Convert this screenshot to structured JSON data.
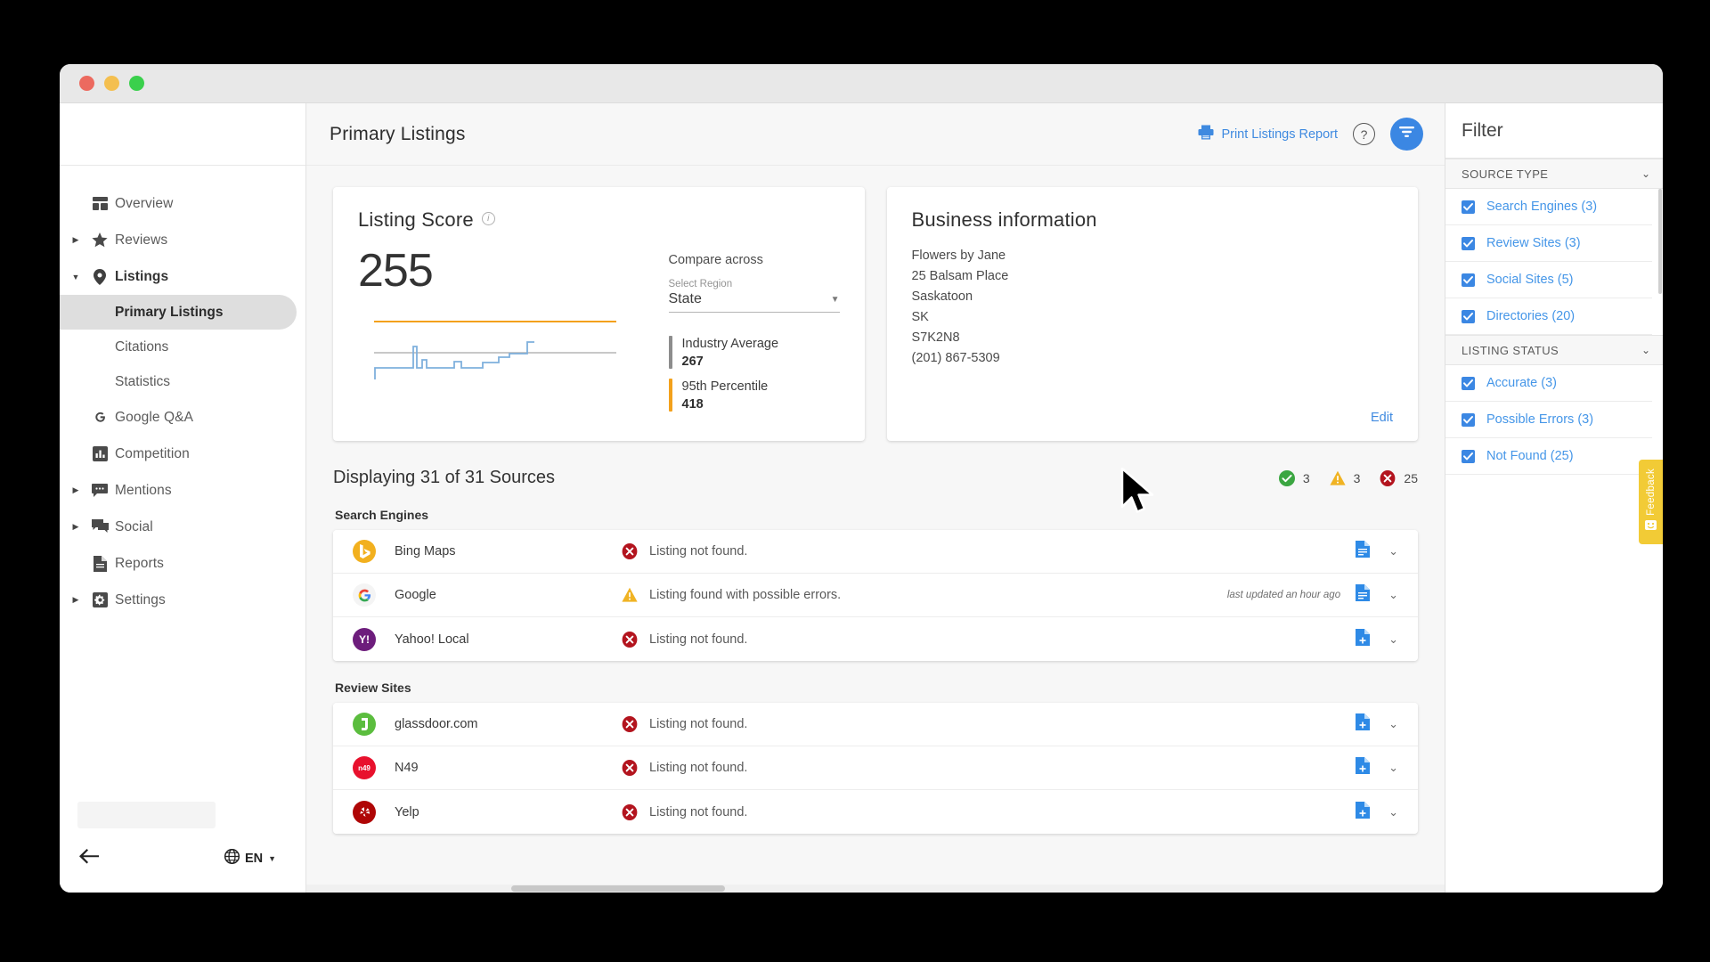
{
  "window": {
    "traffic_lights": [
      "close",
      "minimize",
      "maximize"
    ]
  },
  "sidebar": {
    "items": [
      {
        "label": "Overview",
        "icon": "dashboard-icon",
        "expandable": false,
        "expanded": false
      },
      {
        "label": "Reviews",
        "icon": "star-icon",
        "expandable": true,
        "expanded": false
      },
      {
        "label": "Listings",
        "icon": "location-pin-icon",
        "expandable": true,
        "expanded": true
      },
      {
        "label": "Google Q&A",
        "icon": "google-g-icon",
        "expandable": false,
        "expanded": false
      },
      {
        "label": "Competition",
        "icon": "bar-chart-icon",
        "expandable": false,
        "expanded": false
      },
      {
        "label": "Mentions",
        "icon": "comment-dots-icon",
        "expandable": true,
        "expanded": false
      },
      {
        "label": "Social",
        "icon": "chat-bubbles-icon",
        "expandable": true,
        "expanded": false
      },
      {
        "label": "Reports",
        "icon": "document-icon",
        "expandable": false,
        "expanded": false
      },
      {
        "label": "Settings",
        "icon": "gear-icon",
        "expandable": true,
        "expanded": false
      }
    ],
    "listings_children": [
      {
        "label": "Primary Listings",
        "active": true
      },
      {
        "label": "Citations",
        "active": false
      },
      {
        "label": "Statistics",
        "active": false
      }
    ],
    "footer": {
      "back_icon": "arrow-left-icon",
      "lang_icon": "globe-icon",
      "lang": "EN",
      "lang_caret": "▾"
    }
  },
  "topbar": {
    "title": "Primary Listings",
    "print_label": "Print Listings Report",
    "print_icon": "printer-icon",
    "help_icon": "question-mark-icon",
    "filter_icon": "filter-funnel-icon",
    "accent": "#3b87e3"
  },
  "listing_score": {
    "title": "Listing Score",
    "info_icon": "info-icon",
    "score": "255",
    "compare_label": "Compare across",
    "select_label": "Select Region",
    "select_value": "State",
    "select_caret": "▾",
    "legend": [
      {
        "name": "Industry Average",
        "value": "267",
        "color": "#8d8d8d"
      },
      {
        "name": "95th Percentile",
        "value": "418",
        "color": "#f3a11c"
      }
    ]
  },
  "chart_data": {
    "type": "line",
    "title": "Listing Score",
    "xlabel": "",
    "ylabel": "",
    "ylim": [
      0,
      460
    ],
    "grid": false,
    "legend_position": "right",
    "series": [
      {
        "name": "Listing Score",
        "color": "#7fb0dd",
        "values": [
          120,
          120,
          120,
          215,
          215,
          215,
          215,
          215,
          215,
          215,
          215,
          215,
          215,
          215,
          215,
          215,
          215,
          215,
          330,
          215,
          215,
          240,
          215,
          215,
          215,
          215,
          215,
          215,
          215,
          215,
          215,
          215,
          215,
          215,
          215,
          240,
          215,
          215,
          215,
          215,
          215,
          215,
          240,
          255,
          255,
          255,
          255,
          255,
          255,
          255,
          255,
          255,
          255,
          255,
          255,
          255,
          255,
          255,
          255,
          255,
          255,
          330,
          330
        ]
      },
      {
        "name": "Industry Average",
        "color": "#a8a8a8",
        "type": "hline",
        "value": 267
      },
      {
        "name": "95th Percentile",
        "color": "#f3a11c",
        "type": "hline",
        "value": 418
      }
    ],
    "annotations": [
      {
        "label": "Industry Average",
        "value": 267
      },
      {
        "label": "95th Percentile",
        "value": 418
      }
    ]
  },
  "business_info": {
    "title": "Business information",
    "lines": [
      "Flowers by Jane",
      "25 Balsam Place",
      "Saskatoon",
      "SK",
      "S7K2N8",
      "(201) 867-5309"
    ],
    "edit_label": "Edit"
  },
  "sources": {
    "heading": "Displaying 31 of 31 Sources",
    "counts": [
      {
        "status": "accurate",
        "icon": "check-circle-icon",
        "value": "3",
        "color": "#3ba641"
      },
      {
        "status": "possible-errors",
        "icon": "warning-triangle-icon",
        "value": "3",
        "color": "#f0b323"
      },
      {
        "status": "not-found",
        "icon": "error-circle-icon",
        "value": "25",
        "color": "#b3141e"
      }
    ],
    "groups": [
      {
        "title": "Search Engines",
        "rows": [
          {
            "name": "Bing Maps",
            "logo": "bing-icon",
            "logo_bg": "#f2b01e",
            "status_icon": "error-circle-icon",
            "status": "Listing not found.",
            "updated": "",
            "action_icon": "document-icon",
            "chevron": "chevron-down-icon"
          },
          {
            "name": "Google",
            "logo": "google-icon",
            "logo_bg": "#ffffff",
            "status_icon": "warning-triangle-icon",
            "status": "Listing found with possible errors.",
            "updated": "last updated an hour ago",
            "action_icon": "document-icon",
            "chevron": "chevron-down-icon"
          },
          {
            "name": "Yahoo! Local",
            "logo": "yahoo-icon",
            "logo_bg": "#6d1d7c",
            "status_icon": "error-circle-icon",
            "status": "Listing not found.",
            "updated": "",
            "action_icon": "document-add-icon",
            "chevron": "chevron-down-icon"
          }
        ]
      },
      {
        "title": "Review Sites",
        "rows": [
          {
            "name": "glassdoor.com",
            "logo": "glassdoor-icon",
            "logo_bg": "#5bbd3e",
            "status_icon": "error-circle-icon",
            "status": "Listing not found.",
            "updated": "",
            "action_icon": "document-add-icon",
            "chevron": "chevron-down-icon"
          },
          {
            "name": "N49",
            "logo": "n49-icon",
            "logo_bg": "#e8112d",
            "status_icon": "error-circle-icon",
            "status": "Listing not found.",
            "updated": "",
            "action_icon": "document-add-icon",
            "chevron": "chevron-down-icon"
          },
          {
            "name": "Yelp",
            "logo": "yelp-icon",
            "logo_bg": "#af0606",
            "status_icon": "error-circle-icon",
            "status": "Listing not found.",
            "updated": "",
            "action_icon": "document-add-icon",
            "chevron": "chevron-down-icon"
          }
        ]
      }
    ]
  },
  "filter": {
    "title": "Filter",
    "sections": [
      {
        "label": "SOURCE TYPE",
        "caret": "chevron-down-icon",
        "options": [
          {
            "label": "Search Engines (3)",
            "checked": true
          },
          {
            "label": "Review Sites (3)",
            "checked": true
          },
          {
            "label": "Social Sites (5)",
            "checked": true
          },
          {
            "label": "Directories (20)",
            "checked": true
          }
        ]
      },
      {
        "label": "LISTING STATUS",
        "caret": "chevron-down-icon",
        "options": [
          {
            "label": "Accurate (3)",
            "checked": true
          },
          {
            "label": "Possible Errors (3)",
            "checked": true
          },
          {
            "label": "Not Found (25)",
            "checked": true
          }
        ]
      }
    ]
  },
  "feedback": {
    "label": "Feedback",
    "icon": "smiley-face-icon",
    "color": "#f2cb36"
  }
}
